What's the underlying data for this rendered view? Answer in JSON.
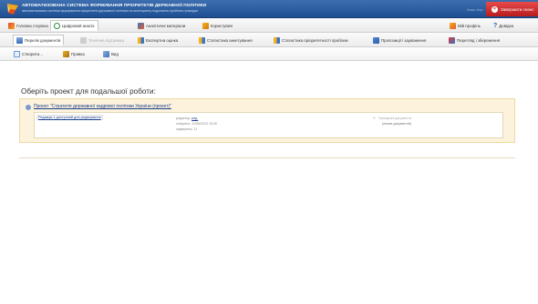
{
  "header": {
    "title": "АВТОМАТИЗОВАНА СИСТЕМА ФОРМУВАННЯ ПРІОРИТЕТІВ ДЕРЖАВНОЇ ПОЛІТИКИ",
    "subtitle": "автоматизована система формування пріоритетів державної політики та моніторингу подолання проблем громадян",
    "user": "Ілько Ігор",
    "logout_label": "Завершити сеанс"
  },
  "nav_main": [
    {
      "label": "Головна сторінка",
      "icon": "pin-icon"
    },
    {
      "label": "Цифровий аналіз",
      "icon": "refresh-icon"
    },
    {
      "label": "Аналітичні матеріали",
      "icon": "users-icon"
    },
    {
      "label": "Користувачі",
      "icon": "people-icon"
    }
  ],
  "nav_right": [
    {
      "label": "Мій профіль",
      "icon": "profile-icon"
    },
    {
      "label": "Довідка",
      "icon": "help-icon"
    }
  ],
  "nav_sub": [
    {
      "label": "Перелік документів",
      "icon": "document-icon",
      "state": "active"
    },
    {
      "label": "Технічна підтримка",
      "icon": "wrench-icon",
      "state": "disabled"
    },
    {
      "label": "Експертна оцінка",
      "icon": "chart-icon",
      "state": "normal"
    },
    {
      "label": "Статистика анкетування",
      "icon": "chart-icon",
      "state": "normal"
    },
    {
      "label": "Статистика пріоритетності проблем",
      "icon": "chart-icon",
      "state": "normal"
    },
    {
      "label": "Пропозиції і зауваження",
      "icon": "message-icon",
      "state": "normal"
    },
    {
      "label": "Перегляд і збереження",
      "icon": "save-icon",
      "state": "normal"
    }
  ],
  "toolbar": [
    {
      "label": "Створити...",
      "icon": "new-icon"
    },
    {
      "label": "Правка",
      "icon": "edit-icon"
    },
    {
      "label": "Вид",
      "icon": "view-icon"
    }
  ],
  "main": {
    "title": "Оберіть проект для подальшої роботи:",
    "project": {
      "link": "Проект \"Стратегія державної кадрової політики України (проект)\"",
      "draft_link": "Редакція 1 доступний для редагування",
      "editor_label": "редактор:",
      "editor_value": "ред.",
      "created_label": "створено:",
      "created_value": "11/06/2010 15:30",
      "notes_label": "зауважень:",
      "notes_value": "11",
      "attach_label": "Приєднані документи:",
      "attach_value": "(немає документів)"
    }
  },
  "colors": {
    "header_bg": "#2b5c9e",
    "logout_bg": "#cf2a2a",
    "panel_bg": "#fdf3dd",
    "link": "#1a3e8c"
  }
}
